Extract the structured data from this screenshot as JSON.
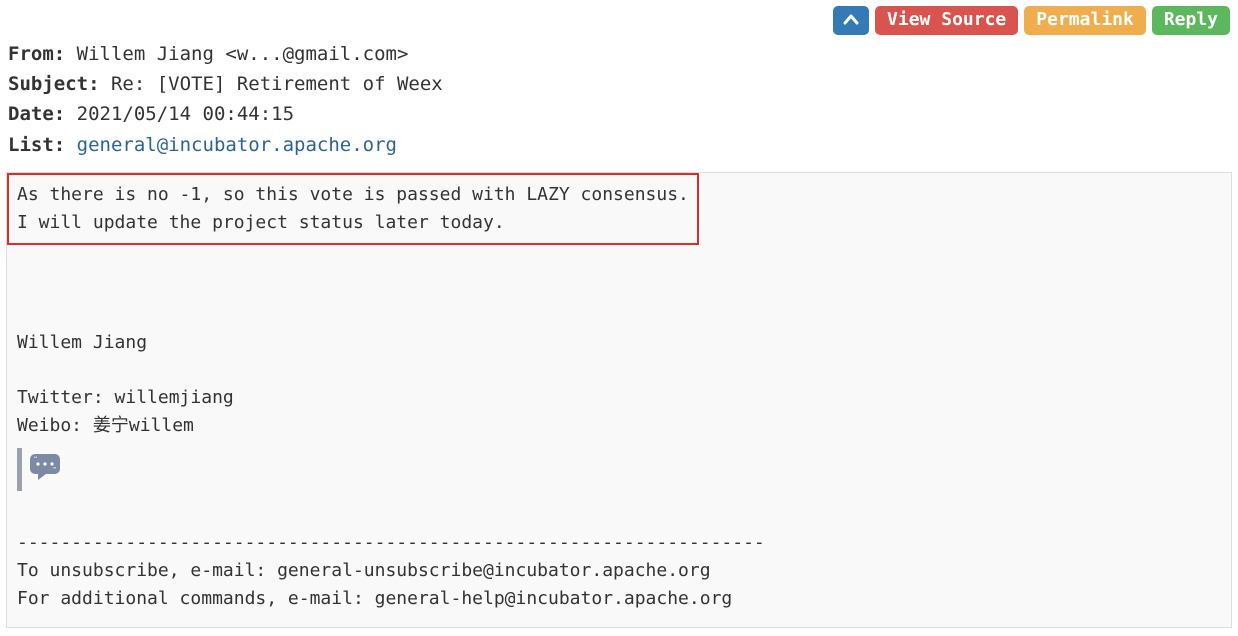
{
  "toolbar": {
    "collapse_label": "",
    "view_source_label": "View Source",
    "permalink_label": "Permalink",
    "reply_label": "Reply"
  },
  "headers": {
    "from_label": "From",
    "from_value": "Willem Jiang <w...@gmail.com>",
    "subject_label": "Subject",
    "subject_value": "Re: [VOTE] Retirement of Weex",
    "date_label": "Date",
    "date_value": "2021/05/14 00:44:15",
    "list_label": "List",
    "list_value": "general@incubator.apache.org"
  },
  "body": {
    "highlight_line1": "As there is no -1, so this vote is passed with LAZY consensus.",
    "highlight_line2": "I will update the project status later today.",
    "sig_name": "Willem Jiang",
    "sig_twitter": "Twitter: willemjiang",
    "sig_weibo": "Weibo: 姜宁willem",
    "divider": "---------------------------------------------------------------------",
    "unsub": "To unsubscribe, e-mail: general-unsubscribe@incubator.apache.org",
    "help": "For additional commands, e-mail: general-help@incubator.apache.org"
  }
}
